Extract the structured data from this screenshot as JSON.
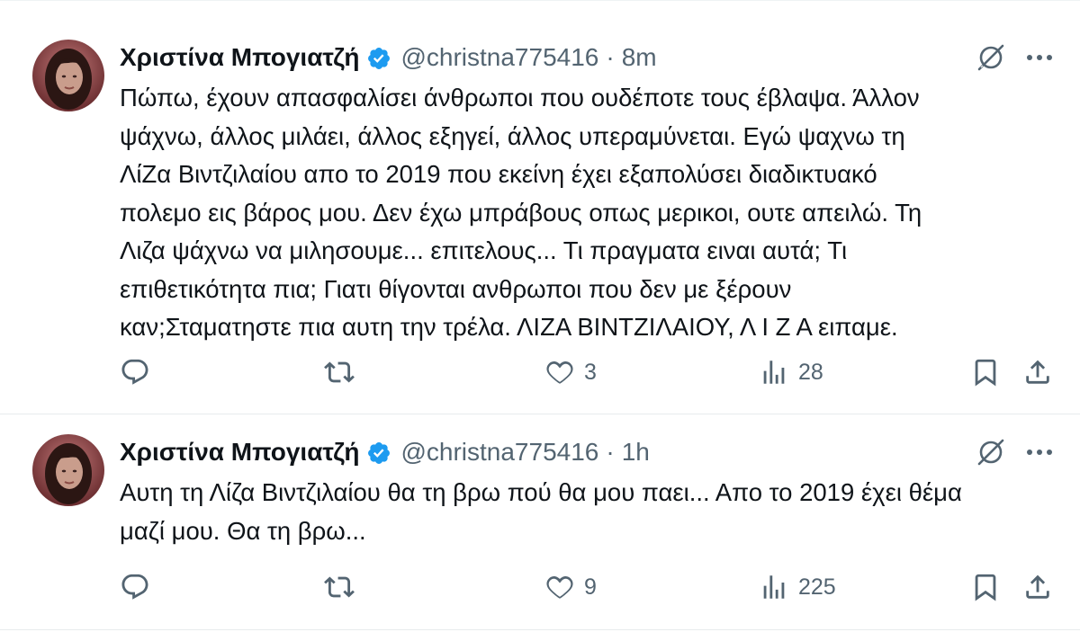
{
  "tweets": [
    {
      "author": {
        "display_name": "Χριστίνα Μπογιατζή",
        "handle": "@christna775416",
        "verified": true
      },
      "separator": "·",
      "time": "8m",
      "text": "Πώπω, έχουν απασφαλίσει άνθρωποι που ουδέποτε τους έβλαψα. Άλλον\nψάχνω, άλλος μιλάει, άλλος εξηγεί, άλλος υπεραμύνεται. Εγώ ψαχνω τη\nΛίΖα Βιντζιλαίου απο το 2019 που εκείνη έχει εξαπολύσει διαδικτυακό\nπολεμο εις βάρος μου. Δεν έχω μπράβους οπως μερικοι, ουτε απειλώ. Τη\nΛιζα ψάχνω να μιλησουμε... επιτελους... Τι πραγματα ειναι αυτά; Τι\nεπιθετικότητα πια; Γιατι θίγονται ανθρωποι που δεν με ξέρουν\nκαν;Σταματηστε πια αυτη την τρέλα.  ΛΙΖΑ ΒΙΝΤΖΙΛΑΙΟΥ, Λ  Ι  Ζ Α ειπαμε.",
      "stats": {
        "replies": "",
        "reposts": "",
        "likes": "3",
        "views": "28"
      }
    },
    {
      "author": {
        "display_name": "Χριστίνα Μπογιατζή",
        "handle": "@christna775416",
        "verified": true
      },
      "separator": "·",
      "time": "1h",
      "text": "Αυτη τη Λίζα Βιντζιλαίου θα τη βρω πού θα μου παει... Απο το 2019 έχει θέμα\nμαζί μου. Θα τη βρω...",
      "stats": {
        "replies": "",
        "reposts": "",
        "likes": "9",
        "views": "225"
      }
    }
  ],
  "icons": {
    "reply": "reply-icon",
    "repost": "repost-icon",
    "like": "heart-icon",
    "views": "analytics-icon",
    "bookmark": "bookmark-icon",
    "share": "share-icon",
    "grok": "grok-icon",
    "more": "more-icon",
    "verified": "verified-badge-icon"
  },
  "colors": {
    "text": "#0f1419",
    "secondary": "#536471",
    "verified": "#1d9bf0",
    "divider": "#e7ebed"
  }
}
